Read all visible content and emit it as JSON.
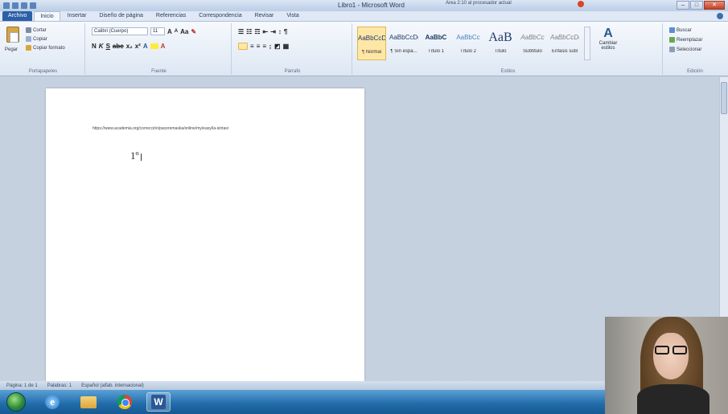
{
  "window": {
    "title": "Libro1 - Microsoft Word",
    "minimize": "–",
    "maximize": "□",
    "close": "✕"
  },
  "tabs": [
    {
      "label": "Archivo"
    },
    {
      "label": "Inicio"
    },
    {
      "label": "Insertar"
    },
    {
      "label": "Diseño de página"
    },
    {
      "label": "Referencias"
    },
    {
      "label": "Correspondencia"
    },
    {
      "label": "Revisar"
    },
    {
      "label": "Vista"
    }
  ],
  "ribbon": {
    "clipboard": {
      "paste": "Pegar",
      "cut": "Cortar",
      "copy": "Copiar",
      "format_painter": "Copiar formato",
      "label": "Portapapeles"
    },
    "font": {
      "font_name": "Calibri (Cuerpo)",
      "font_size": "11",
      "label": "Fuente"
    },
    "paragraph": {
      "label": "Párrafo"
    },
    "styles": {
      "label": "Estilos",
      "items": [
        {
          "sample": "AaBbCcDc",
          "name": "¶ Normal"
        },
        {
          "sample": "AaBbCcDc",
          "name": "¶ Sin espa..."
        },
        {
          "sample": "AaBbC",
          "name": "Título 1"
        },
        {
          "sample": "AaBbCc",
          "name": "Título 2"
        },
        {
          "sample": "AaB",
          "name": "Título"
        },
        {
          "sample": "AaBbCc",
          "name": "Subtítulo"
        },
        {
          "sample": "AaBbCcDc",
          "name": "Énfasis sutil"
        }
      ],
      "change_styles": "Cambiar estilos"
    },
    "editing": {
      "find": "Buscar",
      "replace": "Reemplazar",
      "select": "Seleccionar",
      "label": "Edición"
    }
  },
  "document": {
    "url_text": "https://www.academia.org/corrección/paceremaska/online/my/easy/la-sintaxi",
    "heading_mark": "1º"
  },
  "statusbar": {
    "page": "Página: 1 de 1",
    "words": "Palabras: 1",
    "language": "Español (alfab. internacional)",
    "right_text": "Área 2:10 al procesador actual"
  },
  "taskbar": {
    "word_label": "W",
    "ie_label": "e"
  }
}
